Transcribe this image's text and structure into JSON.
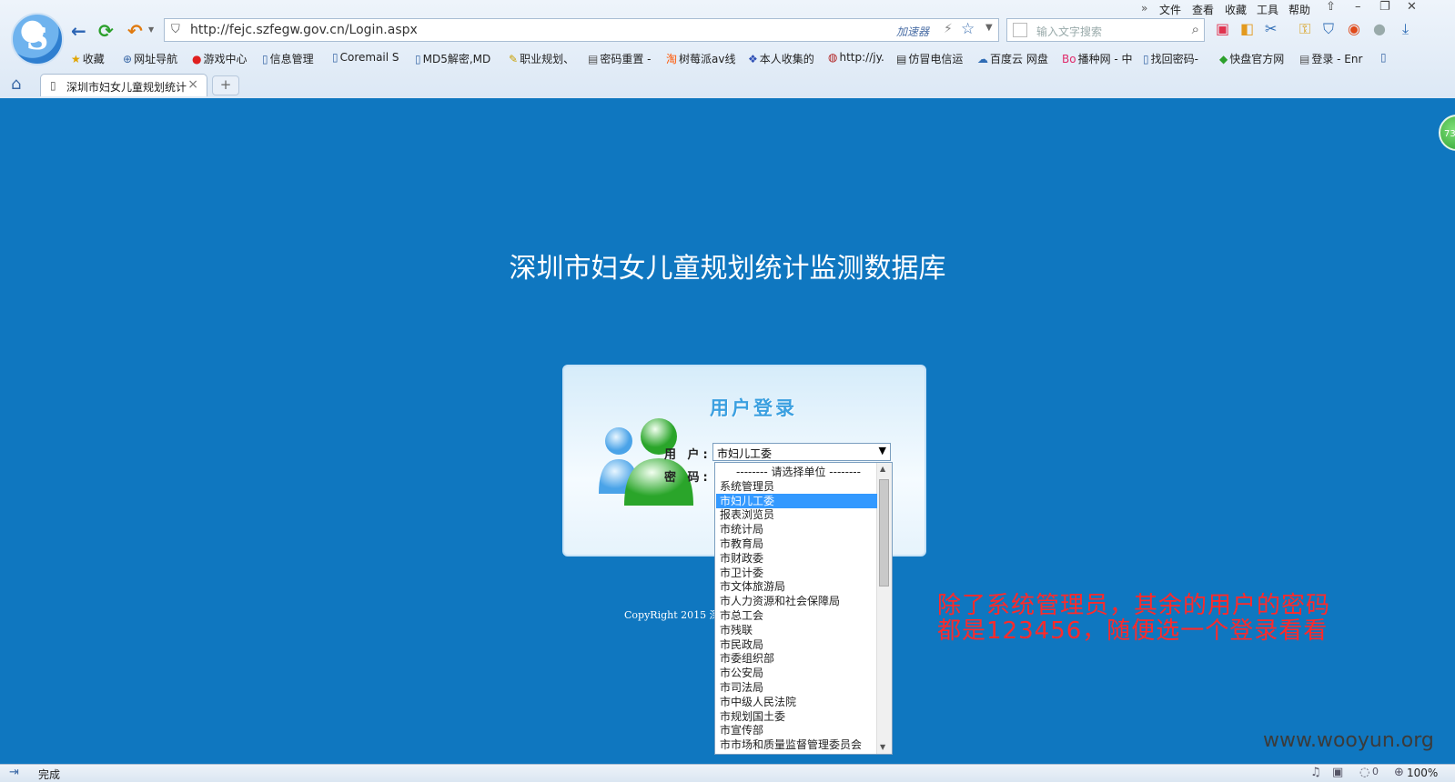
{
  "browser": {
    "url": "http://fejc.szfegw.gov.cn/Login.aspx",
    "accelerator_label": "加速器",
    "search_placeholder": "输入文字搜索",
    "menu": [
      "文件",
      "查看",
      "收藏",
      "工具",
      "帮助"
    ],
    "bookmarks": [
      {
        "label": "收藏",
        "icon": "star-icon"
      },
      {
        "label": "网址导航",
        "icon": "globe-icon"
      },
      {
        "label": "游戏中心",
        "icon": "game-icon"
      },
      {
        "label": "信息管理",
        "icon": "page-icon"
      },
      {
        "label": "Coremail S",
        "icon": "page-icon"
      },
      {
        "label": "MD5解密,MD",
        "icon": "page-icon"
      },
      {
        "label": "职业规划、",
        "icon": "pencil-icon"
      },
      {
        "label": "密码重置 -",
        "icon": "image-icon"
      },
      {
        "label": "树莓派av线",
        "icon": "taobao-icon"
      },
      {
        "label": "本人收集的",
        "icon": "paw-icon"
      },
      {
        "label": "http://jy.",
        "icon": "seal-icon"
      },
      {
        "label": "仿冒电信运",
        "icon": "image-icon"
      },
      {
        "label": "百度云 网盘",
        "icon": "cloud-icon"
      },
      {
        "label": "播种网 - 中",
        "icon": "bo-icon"
      },
      {
        "label": "找回密码-",
        "icon": "page-icon"
      },
      {
        "label": "快盘官方网",
        "icon": "diamond-icon"
      },
      {
        "label": "登录 - Enr",
        "icon": "image-icon"
      }
    ],
    "tab_title": "深圳市妇女儿童规划统计",
    "status_text": "完成",
    "zoom": "100%",
    "status_count": "0",
    "side_badge": "73"
  },
  "page": {
    "title": "深圳市妇女儿童规划统计监测数据库",
    "login_title": "用户登录",
    "user_label": "用 户:",
    "password_label": "密 码:",
    "selected_user": "市妇儿工委",
    "options": [
      "-------- 请选择单位 --------",
      "系统管理员",
      "市妇儿工委",
      "报表浏览员",
      "市统计局",
      "市教育局",
      "市财政委",
      "市卫计委",
      "市文体旅游局",
      "市人力资源和社会保障局",
      "市总工会",
      "市残联",
      "市民政局",
      "市委组织部",
      "市公安局",
      "市司法局",
      "市中级人民法院",
      "市规划国土委",
      "市宣传部",
      "市市场和质量监督管理委员会"
    ],
    "selected_index": 2,
    "copyright": "CopyRight 2015 深",
    "annotation_line1": "除了系统管理员，其余的用户的密码",
    "annotation_line2": "都是123456，随便选一个登录看看",
    "watermark": "www.wooyun.org"
  }
}
